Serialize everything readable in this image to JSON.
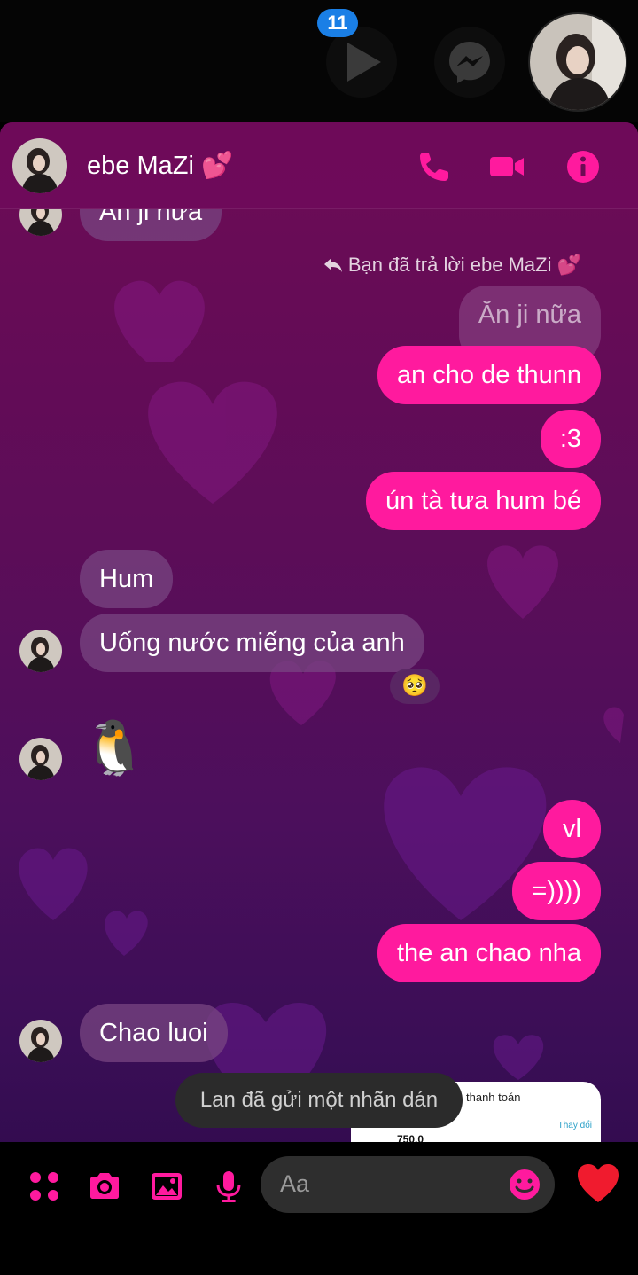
{
  "chat_heads": {
    "unread_badge": "11"
  },
  "header": {
    "contact_name": "ebe MaZi 💕"
  },
  "messages": {
    "partial_top": "Ăn ji nữa",
    "reply_note": "Bạn đã trả lời ebe MaZi 💕",
    "quoted": "Ăn ji nữa",
    "out1": "an cho de thunn",
    "out2": ":3",
    "out3": "ún tà tưa hum bé",
    "in1": "Hum",
    "in2": "Uống nước miếng của anh",
    "reaction": "🥺",
    "sticker": "🐧",
    "out4": "vl",
    "out5": "=))))",
    "out6": "the an chao nha",
    "in3": "Chao luoi",
    "receipt_title": "thanh toán",
    "receipt_change": "Thay đổi",
    "receipt_amount": "750.0"
  },
  "toast": "Lan đã gửi một nhãn dán",
  "composer": {
    "placeholder": "Aa"
  },
  "colors": {
    "accent": "#ff1a9e",
    "incoming_bubble": "#7a4682",
    "panel_top": "#6d0b55",
    "panel_bottom": "#2a0a48"
  },
  "icons": [
    "play-icon",
    "messenger-icon",
    "phone-icon",
    "video-icon",
    "info-icon",
    "reply-icon",
    "apps-icon",
    "camera-icon",
    "image-icon",
    "mic-icon",
    "smile-icon",
    "heart-icon"
  ]
}
